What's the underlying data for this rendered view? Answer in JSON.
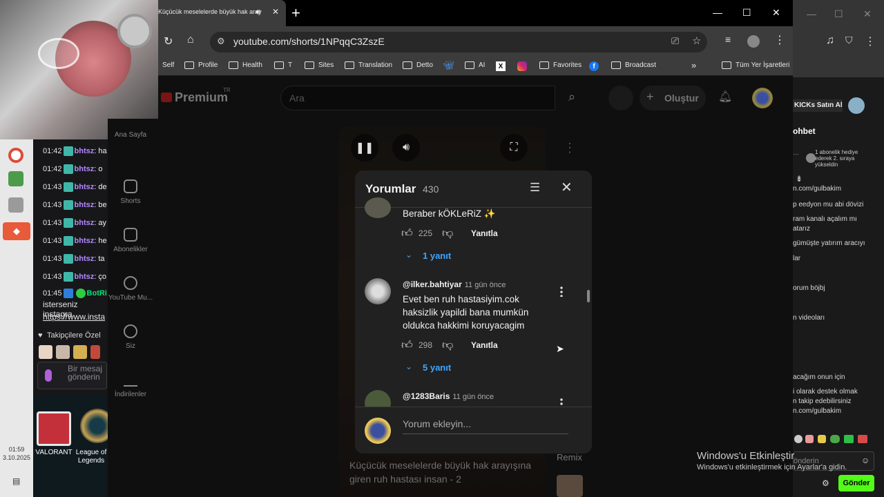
{
  "browser": {
    "tab_title": "Küçücük meselelerde büyük hak aray",
    "url": "youtube.com/shorts/1NPqqC3ZszE",
    "bookmarks": [
      "Self",
      "Profile",
      "Health",
      "T",
      "Sites",
      "Translation",
      "Detto",
      "AI",
      "Favorites",
      "Broadcast"
    ],
    "all_bookmarks": "Tüm Yer İşaretleri"
  },
  "youtube": {
    "logo": "Premium",
    "logo_region": "TR",
    "search_placeholder": "Ara",
    "create_label": "Oluştur",
    "sidebar": [
      "Ana Sayfa",
      "Shorts",
      "Abonelikler",
      "YouTube Mu...",
      "Siz",
      "İndirilenler"
    ],
    "video_caption": "Küçücük meselelerde büyük hak arayışına giren ruh hastası insan - 2",
    "remix": "Remix"
  },
  "comments": {
    "title": "Yorumlar",
    "count": "430",
    "items": [
      {
        "text": "Beraber kÖKLeRiZ ✨",
        "likes": "225",
        "reply": "Yanıtla",
        "replies": "1 yanıt"
      },
      {
        "author": "@ilker.bahtiyar",
        "time": "11 gün önce",
        "text": "Evet ben ruh hastasiyim.cok haksizlik yapildi bana mumkün oldukca hakkimi koruyacagim",
        "likes": "298",
        "reply": "Yanıtla",
        "replies": "5 yanıt"
      },
      {
        "author": "@1283Baris",
        "time": "11 gün önce"
      }
    ],
    "add_placeholder": "Yorum ekleyin..."
  },
  "chat": {
    "lines": [
      {
        "time": "01:42",
        "user": "bhtsz",
        "msg": ": ha"
      },
      {
        "time": "01:42",
        "user": "bhtsz",
        "msg": ": o"
      },
      {
        "time": "01:43",
        "user": "bhtsz",
        "msg": ": de"
      },
      {
        "time": "01:43",
        "user": "bhtsz",
        "msg": ": be"
      },
      {
        "time": "01:43",
        "user": "bhtsz",
        "msg": ": ay"
      },
      {
        "time": "01:43",
        "user": "bhtsz",
        "msg": ": he"
      },
      {
        "time": "01:43",
        "user": "bhtsz",
        "msg": ": ta"
      },
      {
        "time": "01:43",
        "user": "bhtsz",
        "msg": ": ço"
      },
      {
        "time": "01:45",
        "user": "BotRi",
        "msg": ""
      }
    ],
    "bot_msg_1": "isterseniz instagra",
    "bot_msg_2": "https://www.insta",
    "followers_label": "Takipçilere Özel",
    "message_placeholder": "Bir mesaj gönderin"
  },
  "desktop": {
    "icons": [
      "VALORANT",
      "League of Legends"
    ],
    "time": "01:59",
    "date": "3.10.2025"
  },
  "kick": {
    "header_button": "KICKs Satın Al",
    "chat_title": "ohbet",
    "sub_note": "1 abonelik hediye ederek 2. sıraya yükseldin",
    "lines": [
      "n.com/gulbakim",
      "p eedyon mu abi dövizi",
      "ram kanalı açalım mı",
      "atarız",
      "gümüşte yatırım aracıyı",
      "lar",
      "orum böjbj",
      "n videoları",
      "acağım onun için",
      "i olarak destek olmak",
      "n takip edebilirsiniz",
      "n.com/gulbakim"
    ],
    "input_placeholder": "önderin",
    "send": "Gönder"
  },
  "windows_activation": {
    "title": "Windows'u Etkinleştir",
    "subtitle": "Windows'u etkinleştirmek için Ayarlar'a gidin."
  }
}
